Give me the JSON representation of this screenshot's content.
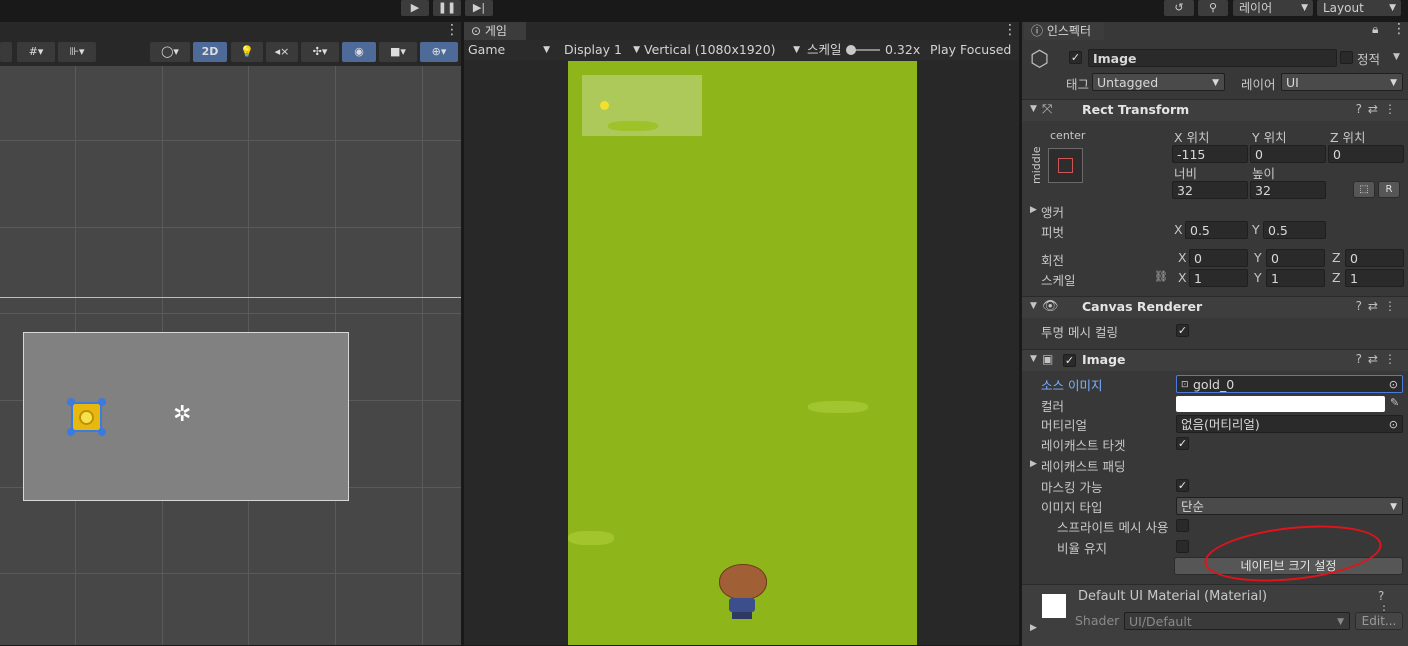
{
  "topbar": {
    "play_icon": "play-icon",
    "pause_icon": "pause-icon",
    "step_icon": "step-icon",
    "layers_label": "레이어",
    "layout_label": "Layout"
  },
  "scene": {
    "mode_2d": "2D"
  },
  "game": {
    "tab_label": "게임",
    "display_select": "Game",
    "display_num": "Display 1",
    "resolution": "Vertical (1080x1920)",
    "scale_label": "스케일",
    "scale_value": "0.32x",
    "play_focused": "Play Focused"
  },
  "inspector": {
    "tab_label": "인스펙터",
    "object_name": "Image",
    "static_label": "정적",
    "tag_label": "태그",
    "tag_value": "Untagged",
    "layer_label": "레이어",
    "layer_value": "UI",
    "rect_transform": {
      "title": "Rect Transform",
      "anchor_h": "center",
      "anchor_v": "middle",
      "pos_x_label": "X 위치",
      "pos_y_label": "Y 위치",
      "pos_z_label": "Z 위치",
      "pos_x": "-115",
      "pos_y": "0",
      "pos_z": "0",
      "width_label": "너비",
      "height_label": "높이",
      "width": "32",
      "height": "32",
      "r_button": "R",
      "anchors_label": "앵커",
      "pivot_label": "피벗",
      "pivot_x": "0.5",
      "pivot_y": "0.5",
      "rotation_label": "회전",
      "rot_x": "0",
      "rot_y": "0",
      "rot_z": "0",
      "scale_label": "스케일",
      "scale_x": "1",
      "scale_y": "1",
      "scale_z": "1",
      "x": "X",
      "y": "Y",
      "z": "Z"
    },
    "canvas_renderer": {
      "title": "Canvas Renderer",
      "cull_label": "투명 메시 컬링"
    },
    "image": {
      "title": "Image",
      "source_label": "소스 이미지",
      "source_value": "gold_0",
      "color_label": "컬러",
      "color_value": "#ffffff",
      "material_label": "머티리얼",
      "material_value": "없음(머티리얼)",
      "raycast_target_label": "레이캐스트 타겟",
      "raycast_padding_label": "레이캐스트 패딩",
      "maskable_label": "마스킹 가능",
      "image_type_label": "이미지 타입",
      "image_type_value": "단순",
      "use_sprite_mesh_label": "스프라이트 메시 사용",
      "preserve_aspect_label": "비율 유지",
      "native_size_button": "네이티브 크기 설정"
    },
    "material": {
      "title": "Default UI Material (Material)",
      "shader_label": "Shader",
      "shader_value": "UI/Default",
      "edit_button": "Edit..."
    }
  }
}
